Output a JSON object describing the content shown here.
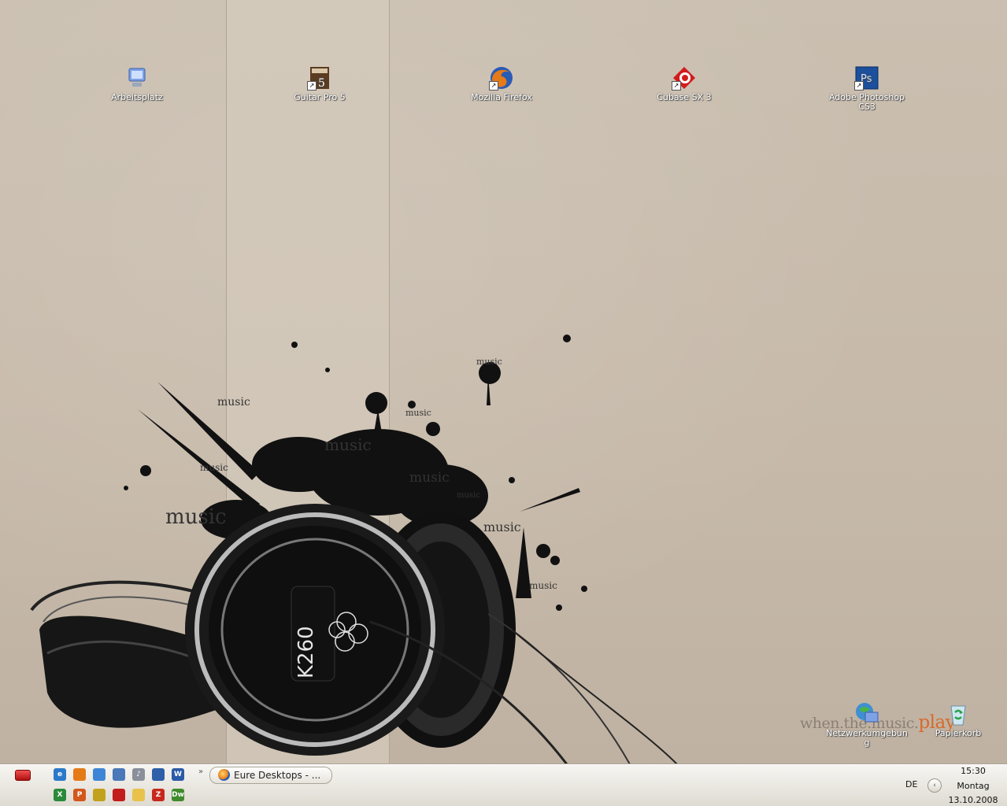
{
  "desktop": {
    "tagline": {
      "part1": "when.the.music.",
      "part2": "play"
    },
    "icons": [
      {
        "label": "Arbeitsplatz",
        "icon": "my-computer-icon",
        "color": "#6a8fd8"
      },
      {
        "label": "Guitar Pro 5",
        "icon": "guitar-pro-icon",
        "color": "#6b4a2c"
      },
      {
        "label": "Mozilla Firefox",
        "icon": "firefox-icon",
        "color": "#e57a19"
      },
      {
        "label": "Cubase SX 3",
        "icon": "cubase-icon",
        "color": "#d21c1c"
      },
      {
        "label": "Adobe Photoshop CS3",
        "icon": "photoshop-icon",
        "color": "#1c4f9c",
        "text": "Ps"
      },
      {
        "label": "Netzwerkumgebung",
        "icon": "network-icon",
        "color": "#3f8fd2"
      },
      {
        "label": "Papierkorb",
        "icon": "recycle-bin-icon",
        "color": "#2aa34a"
      }
    ]
  },
  "taskbar": {
    "quicklaunch": [
      {
        "icon": "ie-icon",
        "color": "#2c79c9",
        "glyph": "e"
      },
      {
        "icon": "firefox-icon",
        "color": "#e57a19",
        "glyph": ""
      },
      {
        "icon": "thermometer-icon",
        "color": "#3d86d6",
        "glyph": ""
      },
      {
        "icon": "thunderbird-icon",
        "color": "#4a78b8",
        "glyph": ""
      },
      {
        "icon": "music-note-icon",
        "color": "#8a8f9a",
        "glyph": "♪"
      },
      {
        "icon": "messenger-icon",
        "color": "#2e5fa8",
        "glyph": ""
      },
      {
        "icon": "word-icon",
        "color": "#2a5aa8",
        "glyph": "W"
      },
      {
        "icon": "excel-icon",
        "color": "#2a8a3a",
        "glyph": "X"
      },
      {
        "icon": "powerpoint-icon",
        "color": "#d2581c",
        "glyph": "P"
      },
      {
        "icon": "network-tool-icon",
        "color": "#c2a21c",
        "glyph": ""
      },
      {
        "icon": "acrobat-icon",
        "color": "#c21c1c",
        "glyph": ""
      },
      {
        "icon": "folder-icon",
        "color": "#e8c24a",
        "glyph": ""
      },
      {
        "icon": "filezilla-icon",
        "color": "#c8281c",
        "glyph": "Z"
      },
      {
        "icon": "dreamweaver-icon",
        "color": "#3f8a2a",
        "glyph": "Dw"
      }
    ],
    "task": {
      "label": "Eure Desktops - ..."
    },
    "tray": {
      "language": "DE",
      "time": "15:30",
      "day": "Montag",
      "date": "13.10.2008"
    }
  }
}
